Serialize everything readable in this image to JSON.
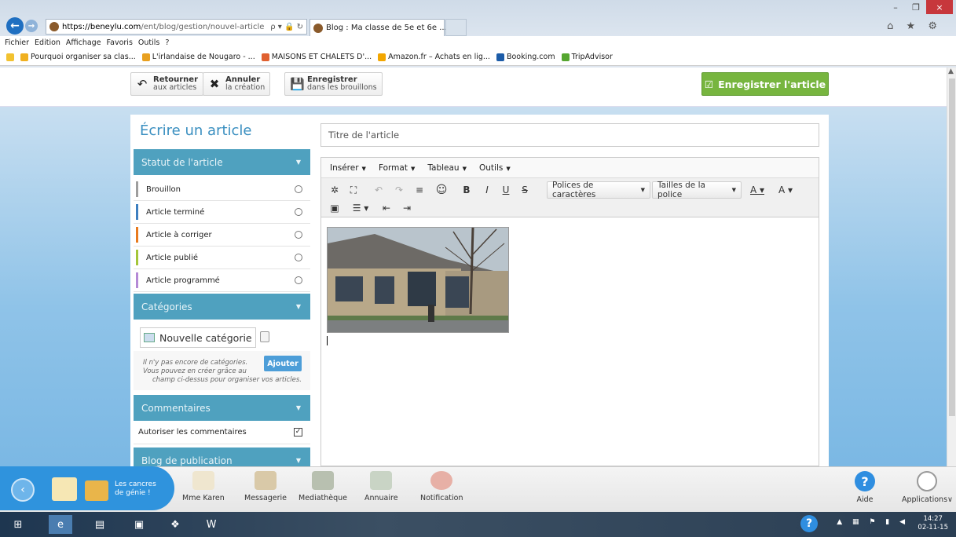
{
  "browser": {
    "url_domain": "https://beneylu.com",
    "url_path": "/ent/blog/gestion/nouvel-article",
    "address_icons": "ρ ▾ 🔒 ↻",
    "tab_title": "Blog : Ma classe de 5e et 6e ...",
    "tab_close": "×",
    "window_controls": [
      "–",
      "❐",
      "×"
    ],
    "toolbar_icons": "⌂ ★ ⚙",
    "menu": [
      "Fichier",
      "Edition",
      "Affichage",
      "Favoris",
      "Outils",
      "?"
    ],
    "favorites": [
      {
        "label": "Pourquoi organiser sa clas...",
        "color": "#f0b020"
      },
      {
        "label": "L'irlandaise de Nougaro - ...",
        "color": "#e8a020"
      },
      {
        "label": "MAISONS ET CHALETS D'...",
        "color": "#e06030"
      },
      {
        "label": "Amazon.fr – Achats en lig...",
        "color": "#f2a600"
      },
      {
        "label": "Booking.com",
        "color": "#1c5ca8"
      },
      {
        "label": "TripAdvisor",
        "color": "#55a630"
      }
    ]
  },
  "toolbar": {
    "back": {
      "line1": "Retourner",
      "line2": "aux articles",
      "icon": "↶"
    },
    "cancel": {
      "line1": "Annuler",
      "line2": "la création",
      "icon": "✖"
    },
    "draft": {
      "line1": "Enregistrer",
      "line2": "dans les brouillons",
      "icon": "💾"
    },
    "save_article": "Enregistrer l'article",
    "save_icon": "☑"
  },
  "left": {
    "heading": "Écrire un article",
    "status_title": "Statut de l'article",
    "statuses": [
      {
        "label": "Brouillon",
        "color": "#9e9e9e"
      },
      {
        "label": "Article terminé",
        "color": "#3d7fc0"
      },
      {
        "label": "Article à corriger",
        "color": "#e87a1e"
      },
      {
        "label": "Article publié",
        "color": "#a4c63a"
      },
      {
        "label": "Article programmé",
        "color": "#b48ad6"
      }
    ],
    "categories_title": "Catégories",
    "category_input_value": "Nouvelle catégorie",
    "category_note": [
      "Il n'y pas encore de catégories.",
      "Vous pouvez en créer grâce au",
      "champ ci-dessus pour organiser vos articles."
    ],
    "add_button": "Ajouter",
    "comments_title": "Commentaires",
    "allow_comments": "Autoriser les commentaires",
    "publication_title": "Blog de publication"
  },
  "editor": {
    "title_placeholder": "Titre de l'article",
    "menu": [
      "Insérer",
      "Format",
      "Tableau",
      "Outils"
    ],
    "font_family": "Polices de caractères",
    "font_size": "Tailles de la police",
    "tool_glyphs": {
      "settings": "✲",
      "fullscreen": "⛶",
      "undo": "↶",
      "redo": "↷",
      "align": "≡",
      "emoji": "☺",
      "bold": "B",
      "italic": "I",
      "underline": "U",
      "strike": "S",
      "text_color": "A ▾",
      "bg_color": "A ▾",
      "media": "▣",
      "list": "☰ ▾",
      "outdent": "⇤",
      "indent": "⇥"
    }
  },
  "appbar": {
    "class_name_line1": "Les cancres",
    "class_name_line2": "de génie !",
    "back_icon": "‹",
    "apps": [
      "Mme Karen",
      "Messagerie",
      "Mediathèque",
      "Annuaire",
      "Notification"
    ],
    "help": "Aide",
    "help_icon": "?",
    "applications": "Applications∨"
  },
  "taskbar": {
    "time": "14:27",
    "date": "02-11-15"
  }
}
